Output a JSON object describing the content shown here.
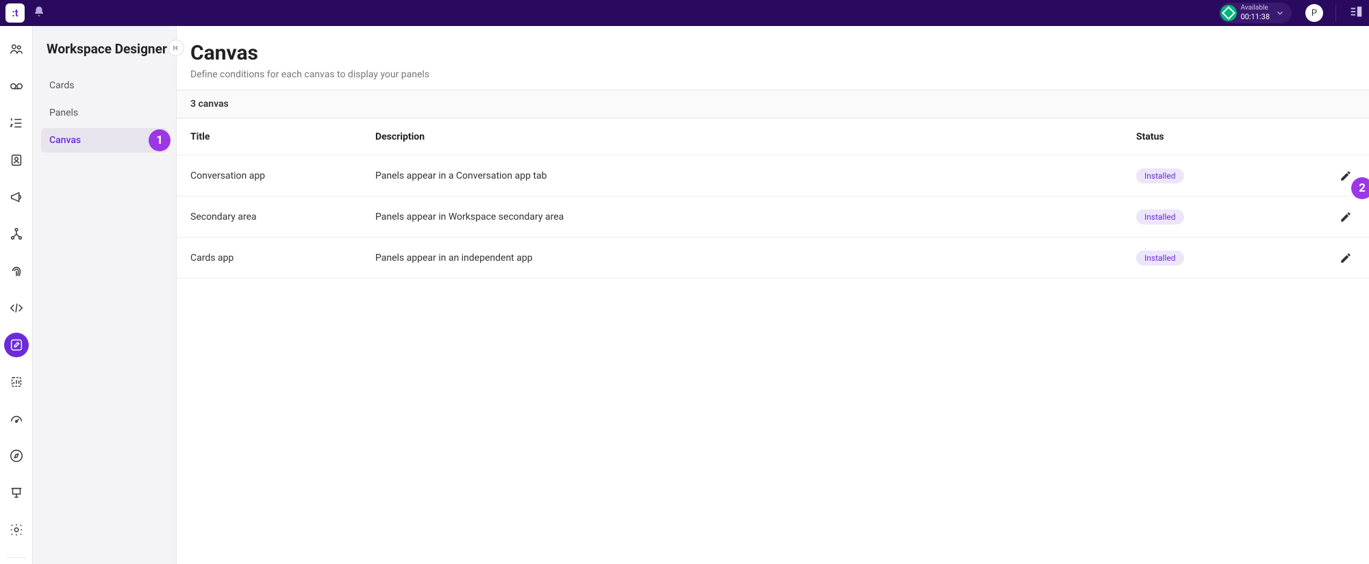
{
  "header": {
    "app_initial": ":t",
    "status_label": "Available",
    "status_time": "00:11:38",
    "avatar_initial": "P"
  },
  "sidebar": {
    "title": "Workspace Designer",
    "items": [
      {
        "label": "Cards"
      },
      {
        "label": "Panels"
      },
      {
        "label": "Canvas"
      }
    ]
  },
  "page": {
    "title": "Canvas",
    "subtitle": "Define conditions for each canvas to display your panels",
    "count_label": "3 canvas"
  },
  "table": {
    "columns": {
      "title": "Title",
      "description": "Description",
      "status": "Status"
    },
    "rows": [
      {
        "title": "Conversation app",
        "description": "Panels appear in a Conversation app tab",
        "status": "Installed"
      },
      {
        "title": "Secondary area",
        "description": "Panels appear in Workspace secondary area",
        "status": "Installed"
      },
      {
        "title": "Cards app",
        "description": "Panels appear in an independent app",
        "status": "Installed"
      }
    ]
  },
  "callouts": {
    "one": "1",
    "two": "2"
  }
}
